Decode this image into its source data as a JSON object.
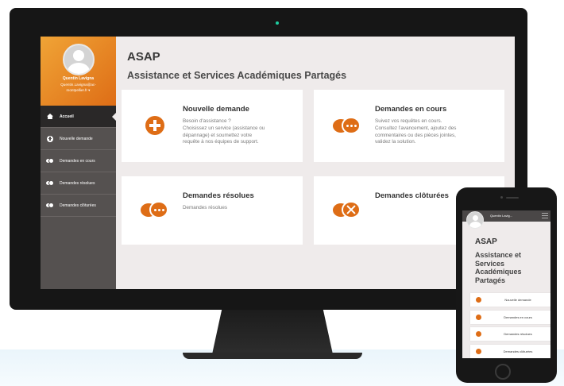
{
  "app": {
    "title": "ASAP",
    "subtitle": "Assistance et Services Académiques Partagés"
  },
  "user": {
    "name": "Quentin Lavigna",
    "email_lines": [
      "Quentin.Lavigna@ac-",
      "montpellier.fr ▾"
    ]
  },
  "menu": [
    {
      "label": "Accueil",
      "icon": "home-icon",
      "active": true
    },
    {
      "label": "Nouvelle demande",
      "icon": "plus-circle-icon"
    },
    {
      "label": "Demandes en cours",
      "icon": "chat-bubbles-icon"
    },
    {
      "label": "Demandes résolues",
      "icon": "chat-bubbles-icon"
    },
    {
      "label": "Demandes clôturées",
      "icon": "chat-bubbles-closed-icon"
    }
  ],
  "cards": [
    {
      "title": "Nouvelle demande",
      "icon": "plus-circle-icon",
      "desc": [
        "Besoin d'assistance ?",
        "Choisissez un service (assistance ou",
        "dépannage) et soumettez votre",
        "requête à nos équipes de support."
      ]
    },
    {
      "title": "Demandes en cours",
      "icon": "chat-bubbles-icon",
      "desc": [
        "Suivez vos requêtes en cours.",
        "Consultez l'avancement, ajoutez des",
        "commentaires ou des pièces jointes,",
        "validez la solution."
      ]
    },
    {
      "title": "Demandes résolues",
      "icon": "chat-bubbles-icon",
      "desc": [
        "Demandes résolues"
      ]
    },
    {
      "title": "Demandes clôturées",
      "icon": "chat-bubbles-closed-icon",
      "desc": []
    }
  ],
  "mobile": {
    "user": "Quentin Lavig...",
    "title": "ASAP",
    "subtitle_lines": [
      "Assistance et",
      "Services",
      "Académiques",
      "Partagés"
    ],
    "items": [
      "Nouvelle demande",
      "Demandes en cours",
      "Demandes résolues",
      "Demandes clôturées"
    ]
  },
  "colors": {
    "accent": "#de6d16",
    "sidebar": "#555150",
    "background": "#efebeb"
  }
}
